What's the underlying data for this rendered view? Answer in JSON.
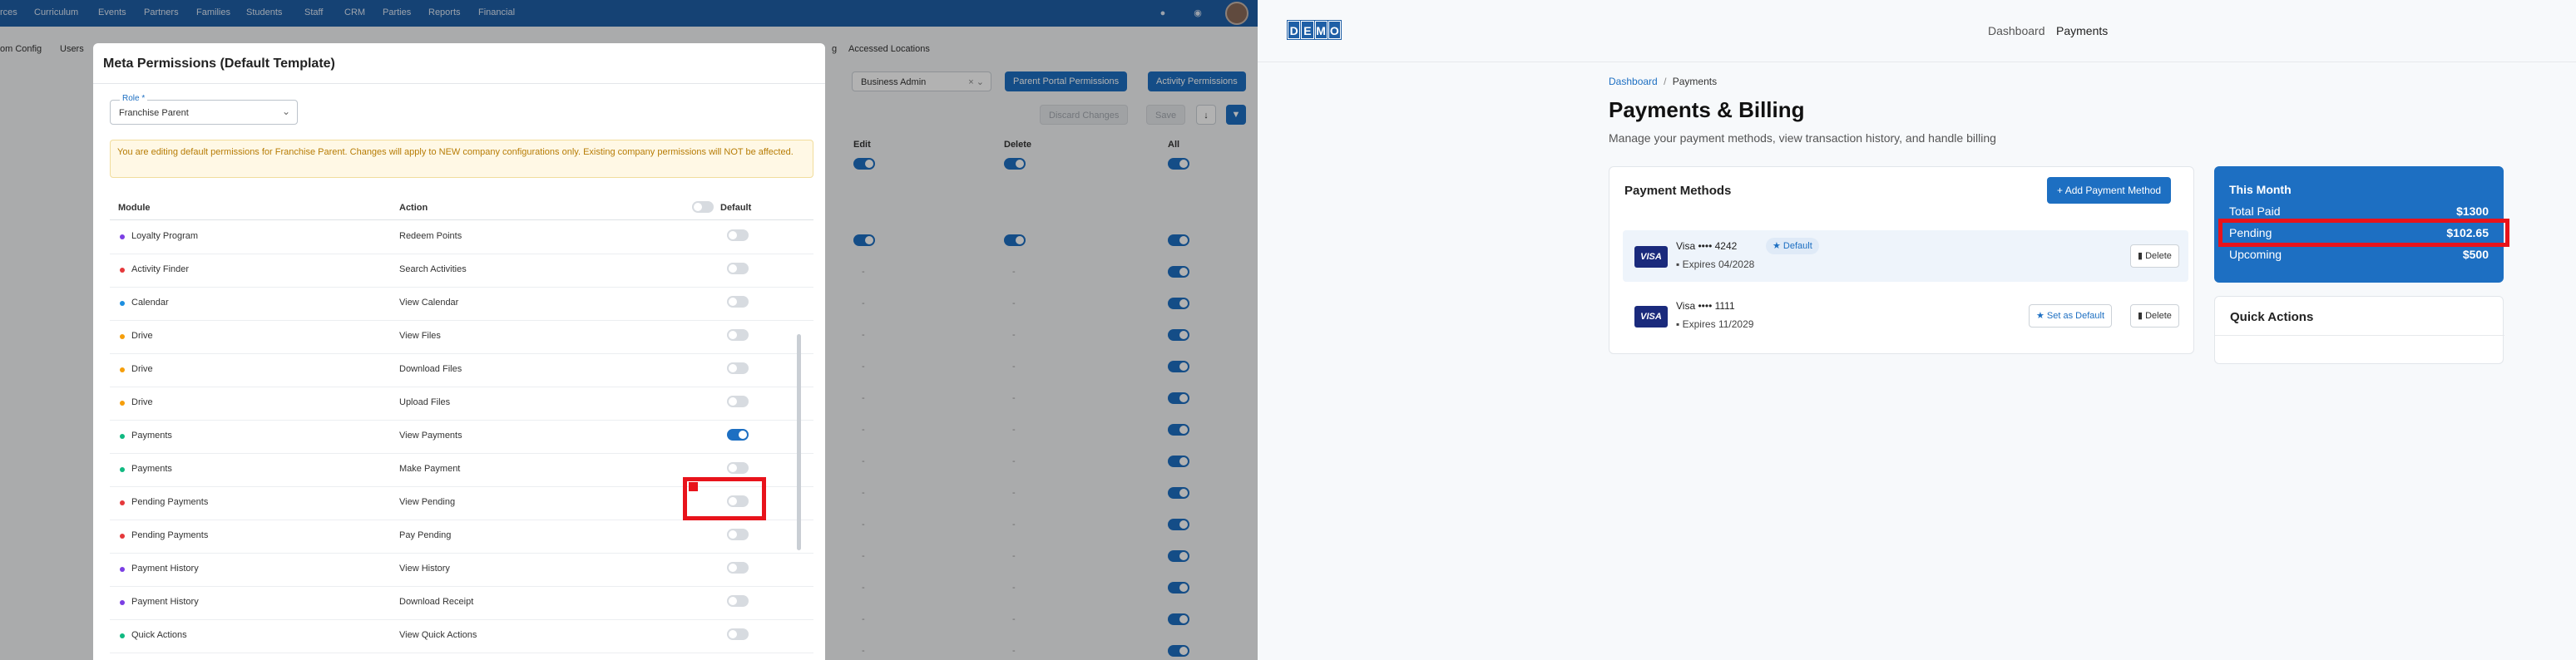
{
  "left_app": {
    "top_nav": [
      "rces",
      "Curriculum",
      "Events",
      "Partners",
      "Families",
      "Students",
      "Staff",
      "CRM",
      "Parties",
      "Reports",
      "Financial"
    ],
    "top_icons": [
      "bell-icon",
      "help-icon"
    ],
    "sub_nav": [
      "om Config",
      "Users",
      "g",
      "Accessed Locations"
    ],
    "role_select_value": "Business Admin",
    "parent_portal_button": "Parent Portal Permissions",
    "activity_button": "Activity Permissions",
    "discard_button": "Discard Changes",
    "save_button": "Save",
    "columns": [
      "Edit",
      "Delete",
      "All"
    ],
    "dash": "-"
  },
  "modal": {
    "title": "Meta Permissions (Default Template)",
    "role_label": "Role *",
    "role_value": "Franchise Parent",
    "warning": "You are editing default permissions for Franchise Parent. Changes will apply to NEW company configurations only. Existing company permissions will NOT be affected.",
    "headers": {
      "module": "Module",
      "action": "Action",
      "default": "Default"
    },
    "rows": [
      {
        "module": "Loyalty Program",
        "action": "Redeem Points",
        "on": false,
        "dot": "#7b3fe4"
      },
      {
        "module": "Activity Finder",
        "action": "Search Activities",
        "on": false,
        "dot": "#e5383b"
      },
      {
        "module": "Calendar",
        "action": "View Calendar",
        "on": false,
        "dot": "#1d8fe0"
      },
      {
        "module": "Drive",
        "action": "View Files",
        "on": false,
        "dot": "#f59e0b"
      },
      {
        "module": "Drive",
        "action": "Download Files",
        "on": false,
        "dot": "#f59e0b"
      },
      {
        "module": "Drive",
        "action": "Upload Files",
        "on": false,
        "dot": "#f59e0b"
      },
      {
        "module": "Payments",
        "action": "View Payments",
        "on": true,
        "dot": "#10b981"
      },
      {
        "module": "Payments",
        "action": "Make Payment",
        "on": false,
        "dot": "#10b981"
      },
      {
        "module": "Pending Payments",
        "action": "View Pending",
        "on": false,
        "dot": "#e5383b"
      },
      {
        "module": "Pending Payments",
        "action": "Pay Pending",
        "on": false,
        "dot": "#e5383b"
      },
      {
        "module": "Payment History",
        "action": "View History",
        "on": false,
        "dot": "#7b3fe4"
      },
      {
        "module": "Payment History",
        "action": "Download Receipt",
        "on": false,
        "dot": "#7b3fe4"
      },
      {
        "module": "Quick Actions",
        "action": "View Quick Actions",
        "on": false,
        "dot": "#10b981"
      }
    ]
  },
  "right_app": {
    "logo": [
      "D",
      "E",
      "M",
      "O"
    ],
    "nav": {
      "dashboard": "Dashboard",
      "payments": "Payments"
    },
    "breadcrumb": {
      "root": "Dashboard",
      "sep": "/",
      "current": "Payments"
    },
    "title": "Payments & Billing",
    "subtitle": "Manage your payment methods, view transaction history, and handle billing",
    "methods_title": "Payment Methods",
    "add_button": "Add Payment Method",
    "methods": [
      {
        "brand": "VISA",
        "name": "Visa •••• 4242",
        "expires": "Expires 04/2028",
        "default_badge": "Default",
        "delete": "Delete"
      },
      {
        "brand": "VISA",
        "name": "Visa •••• 1111",
        "expires": "Expires 11/2029",
        "set_default": "Set as Default",
        "delete": "Delete"
      }
    ],
    "this_month": {
      "title": "This Month",
      "total_paid_label": "Total Paid",
      "total_paid": "$1300",
      "pending_label": "Pending",
      "pending": "$102.65",
      "upcoming_label": "Upcoming",
      "upcoming": "$500"
    },
    "quick_actions_title": "Quick Actions"
  }
}
